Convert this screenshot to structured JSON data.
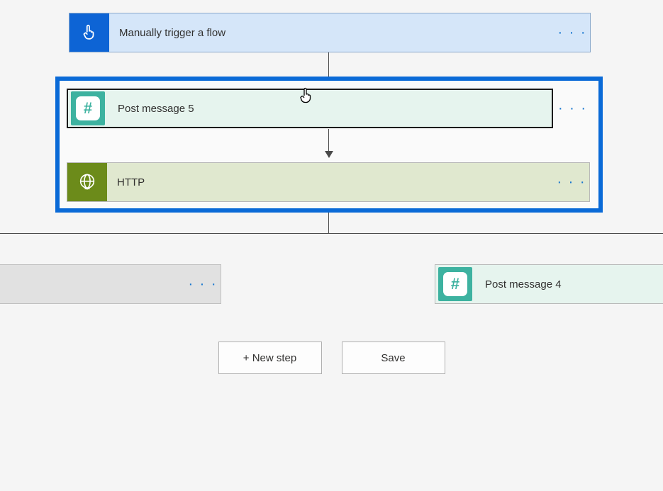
{
  "trigger": {
    "label": "Manually trigger a flow"
  },
  "scope": {
    "step1": {
      "label": "Post message 5"
    },
    "step2": {
      "label": "HTTP"
    }
  },
  "branches": {
    "right": {
      "label": "Post message 4"
    }
  },
  "buttons": {
    "new_step": "+ New step",
    "save": "Save"
  },
  "ellipsis": "· · ·"
}
